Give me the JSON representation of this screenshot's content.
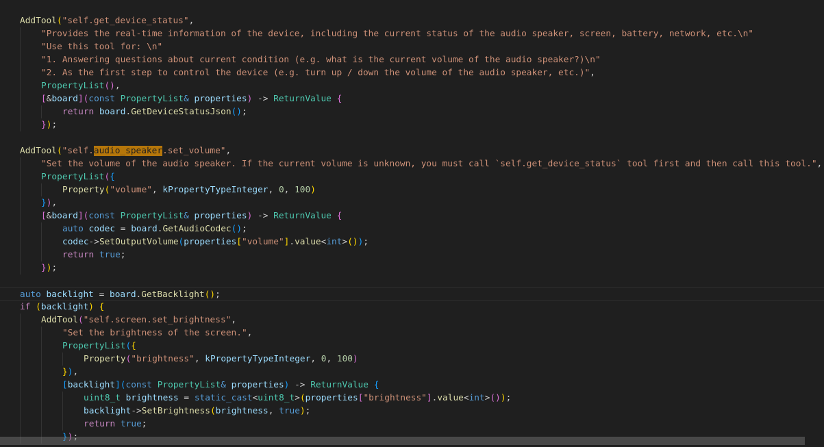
{
  "editor": {
    "lines": [
      {
        "indent": 1,
        "tokens": [
          [
            "func",
            "AddTool"
          ],
          [
            "p1",
            "("
          ],
          [
            "str",
            "\"self.get_device_status\""
          ],
          [
            "plain",
            ","
          ]
        ]
      },
      {
        "indent": 2,
        "tokens": [
          [
            "str",
            "\"Provides the real-time information of the device, including the current status of the audio speaker, screen, battery, network, etc.\\n\""
          ]
        ]
      },
      {
        "indent": 2,
        "tokens": [
          [
            "str",
            "\"Use this tool for: \\n\""
          ]
        ]
      },
      {
        "indent": 2,
        "tokens": [
          [
            "str",
            "\"1. Answering questions about current condition (e.g. what is the current volume of the audio speaker?)\\n\""
          ]
        ]
      },
      {
        "indent": 2,
        "tokens": [
          [
            "str",
            "\"2. As the first step to control the device (e.g. turn up / down the volume of the audio speaker, etc.)\""
          ],
          [
            "plain",
            ","
          ]
        ]
      },
      {
        "indent": 2,
        "tokens": [
          [
            "type",
            "PropertyList"
          ],
          [
            "p2",
            "()"
          ],
          [
            "plain",
            ","
          ]
        ]
      },
      {
        "indent": 2,
        "tokens": [
          [
            "p2",
            "["
          ],
          [
            "plain",
            "&"
          ],
          [
            "var",
            "board"
          ],
          [
            "p2",
            "]("
          ],
          [
            "kw",
            "const"
          ],
          [
            "plain",
            " "
          ],
          [
            "type",
            "PropertyList"
          ],
          [
            "kw",
            "&"
          ],
          [
            "plain",
            " "
          ],
          [
            "var",
            "properties"
          ],
          [
            "p2",
            ")"
          ],
          [
            "plain",
            " -> "
          ],
          [
            "type",
            "ReturnValue"
          ],
          [
            "plain",
            " "
          ],
          [
            "p2",
            "{"
          ]
        ]
      },
      {
        "indent": 3,
        "tokens": [
          [
            "ctl",
            "return"
          ],
          [
            "plain",
            " "
          ],
          [
            "var",
            "board"
          ],
          [
            "plain",
            "."
          ],
          [
            "func",
            "GetDeviceStatusJson"
          ],
          [
            "p3",
            "()"
          ],
          [
            "plain",
            ";"
          ]
        ]
      },
      {
        "indent": 2,
        "tokens": [
          [
            "p2",
            "}"
          ],
          [
            "p1",
            ")"
          ],
          [
            "plain",
            ";"
          ]
        ]
      },
      {
        "indent": 0,
        "tokens": []
      },
      {
        "indent": 1,
        "tokens": [
          [
            "func",
            "AddTool"
          ],
          [
            "p1",
            "("
          ],
          [
            "str",
            "\"self."
          ],
          [
            "hl",
            "audio_speaker"
          ],
          [
            "str",
            ".set_volume\""
          ],
          [
            "plain",
            ","
          ]
        ]
      },
      {
        "indent": 2,
        "tokens": [
          [
            "str",
            "\"Set the volume of the audio speaker. If the current volume is unknown, you must call `self.get_device_status` tool first and then call this tool.\""
          ],
          [
            "plain",
            ","
          ]
        ]
      },
      {
        "indent": 2,
        "tokens": [
          [
            "type",
            "PropertyList"
          ],
          [
            "p2",
            "("
          ],
          [
            "p3",
            "{"
          ]
        ]
      },
      {
        "indent": 3,
        "tokens": [
          [
            "func",
            "Property"
          ],
          [
            "p1",
            "("
          ],
          [
            "str",
            "\"volume\""
          ],
          [
            "plain",
            ", "
          ],
          [
            "var",
            "kPropertyTypeInteger"
          ],
          [
            "plain",
            ", "
          ],
          [
            "num",
            "0"
          ],
          [
            "plain",
            ", "
          ],
          [
            "num",
            "100"
          ],
          [
            "p1",
            ")"
          ]
        ]
      },
      {
        "indent": 2,
        "tokens": [
          [
            "p3",
            "}"
          ],
          [
            "p2",
            ")"
          ],
          [
            "plain",
            ","
          ]
        ]
      },
      {
        "indent": 2,
        "tokens": [
          [
            "p2",
            "["
          ],
          [
            "plain",
            "&"
          ],
          [
            "var",
            "board"
          ],
          [
            "p2",
            "]("
          ],
          [
            "kw",
            "const"
          ],
          [
            "plain",
            " "
          ],
          [
            "type",
            "PropertyList"
          ],
          [
            "kw",
            "&"
          ],
          [
            "plain",
            " "
          ],
          [
            "var",
            "properties"
          ],
          [
            "p2",
            ")"
          ],
          [
            "plain",
            " -> "
          ],
          [
            "type",
            "ReturnValue"
          ],
          [
            "plain",
            " "
          ],
          [
            "p2",
            "{"
          ]
        ]
      },
      {
        "indent": 3,
        "tokens": [
          [
            "kw",
            "auto"
          ],
          [
            "plain",
            " "
          ],
          [
            "var",
            "codec"
          ],
          [
            "plain",
            " = "
          ],
          [
            "var",
            "board"
          ],
          [
            "plain",
            "."
          ],
          [
            "func",
            "GetAudioCodec"
          ],
          [
            "p3",
            "()"
          ],
          [
            "plain",
            ";"
          ]
        ]
      },
      {
        "indent": 3,
        "tokens": [
          [
            "var",
            "codec"
          ],
          [
            "plain",
            "->"
          ],
          [
            "func",
            "SetOutputVolume"
          ],
          [
            "p3",
            "("
          ],
          [
            "var",
            "properties"
          ],
          [
            "p1",
            "["
          ],
          [
            "str",
            "\"volume\""
          ],
          [
            "p1",
            "]"
          ],
          [
            "plain",
            "."
          ],
          [
            "func",
            "value"
          ],
          [
            "plain",
            "<"
          ],
          [
            "kw",
            "int"
          ],
          [
            "plain",
            ">"
          ],
          [
            "p1",
            "()"
          ],
          [
            "p3",
            ")"
          ],
          [
            "plain",
            ";"
          ]
        ]
      },
      {
        "indent": 3,
        "tokens": [
          [
            "ctl",
            "return"
          ],
          [
            "plain",
            " "
          ],
          [
            "kw",
            "true"
          ],
          [
            "plain",
            ";"
          ]
        ]
      },
      {
        "indent": 2,
        "tokens": [
          [
            "p2",
            "}"
          ],
          [
            "p1",
            ")"
          ],
          [
            "plain",
            ";"
          ]
        ]
      },
      {
        "indent": 0,
        "tokens": []
      },
      {
        "indent": 1,
        "current": true,
        "tokens": [
          [
            "kw",
            "auto"
          ],
          [
            "plain",
            " "
          ],
          [
            "var",
            "backlight"
          ],
          [
            "plain",
            " = "
          ],
          [
            "var",
            "board"
          ],
          [
            "plain",
            "."
          ],
          [
            "func",
            "GetBacklight"
          ],
          [
            "p1",
            "()"
          ],
          [
            "plain",
            ";"
          ]
        ]
      },
      {
        "indent": 1,
        "tokens": [
          [
            "ctl",
            "if"
          ],
          [
            "plain",
            " "
          ],
          [
            "p1",
            "("
          ],
          [
            "var",
            "backlight"
          ],
          [
            "p1",
            ")"
          ],
          [
            "plain",
            " "
          ],
          [
            "p1",
            "{"
          ]
        ]
      },
      {
        "indent": 2,
        "tokens": [
          [
            "func",
            "AddTool"
          ],
          [
            "p2",
            "("
          ],
          [
            "str",
            "\"self.screen.set_brightness\""
          ],
          [
            "plain",
            ","
          ]
        ]
      },
      {
        "indent": 3,
        "tokens": [
          [
            "str",
            "\"Set the brightness of the screen.\""
          ],
          [
            "plain",
            ","
          ]
        ]
      },
      {
        "indent": 3,
        "tokens": [
          [
            "type",
            "PropertyList"
          ],
          [
            "p3",
            "("
          ],
          [
            "p1",
            "{"
          ]
        ]
      },
      {
        "indent": 4,
        "tokens": [
          [
            "func",
            "Property"
          ],
          [
            "p2",
            "("
          ],
          [
            "str",
            "\"brightness\""
          ],
          [
            "plain",
            ", "
          ],
          [
            "var",
            "kPropertyTypeInteger"
          ],
          [
            "plain",
            ", "
          ],
          [
            "num",
            "0"
          ],
          [
            "plain",
            ", "
          ],
          [
            "num",
            "100"
          ],
          [
            "p2",
            ")"
          ]
        ]
      },
      {
        "indent": 3,
        "tokens": [
          [
            "p1",
            "}"
          ],
          [
            "p3",
            ")"
          ],
          [
            "plain",
            ","
          ]
        ]
      },
      {
        "indent": 3,
        "tokens": [
          [
            "p3",
            "["
          ],
          [
            "var",
            "backlight"
          ],
          [
            "p3",
            "]("
          ],
          [
            "kw",
            "const"
          ],
          [
            "plain",
            " "
          ],
          [
            "type",
            "PropertyList"
          ],
          [
            "kw",
            "&"
          ],
          [
            "plain",
            " "
          ],
          [
            "var",
            "properties"
          ],
          [
            "p3",
            ")"
          ],
          [
            "plain",
            " -> "
          ],
          [
            "type",
            "ReturnValue"
          ],
          [
            "plain",
            " "
          ],
          [
            "p3",
            "{"
          ]
        ]
      },
      {
        "indent": 4,
        "tokens": [
          [
            "type",
            "uint8_t"
          ],
          [
            "plain",
            " "
          ],
          [
            "var",
            "brightness"
          ],
          [
            "plain",
            " = "
          ],
          [
            "kw",
            "static_cast"
          ],
          [
            "plain",
            "<"
          ],
          [
            "type",
            "uint8_t"
          ],
          [
            "plain",
            ">"
          ],
          [
            "p1",
            "("
          ],
          [
            "var",
            "properties"
          ],
          [
            "p2",
            "["
          ],
          [
            "str",
            "\"brightness\""
          ],
          [
            "p2",
            "]"
          ],
          [
            "plain",
            "."
          ],
          [
            "func",
            "value"
          ],
          [
            "plain",
            "<"
          ],
          [
            "kw",
            "int"
          ],
          [
            "plain",
            ">"
          ],
          [
            "p2",
            "()"
          ],
          [
            "p1",
            ")"
          ],
          [
            "plain",
            ";"
          ]
        ]
      },
      {
        "indent": 4,
        "tokens": [
          [
            "var",
            "backlight"
          ],
          [
            "plain",
            "->"
          ],
          [
            "func",
            "SetBrightness"
          ],
          [
            "p1",
            "("
          ],
          [
            "var",
            "brightness"
          ],
          [
            "plain",
            ", "
          ],
          [
            "kw",
            "true"
          ],
          [
            "p1",
            ")"
          ],
          [
            "plain",
            ";"
          ]
        ]
      },
      {
        "indent": 4,
        "tokens": [
          [
            "ctl",
            "return"
          ],
          [
            "plain",
            " "
          ],
          [
            "kw",
            "true"
          ],
          [
            "plain",
            ";"
          ]
        ]
      },
      {
        "indent": 3,
        "tokens": [
          [
            "p3",
            "}"
          ],
          [
            "p2",
            ")"
          ],
          [
            "plain",
            ";"
          ]
        ]
      }
    ]
  },
  "colors": {
    "background": "#1f1f1f",
    "function": "#dcdcaa",
    "string": "#ce9178",
    "keyword": "#569cd6",
    "control": "#c586c0",
    "type": "#4ec9b0",
    "variable": "#9cdcfe",
    "number": "#b5cea8",
    "search_highlight": "#b5760a"
  }
}
